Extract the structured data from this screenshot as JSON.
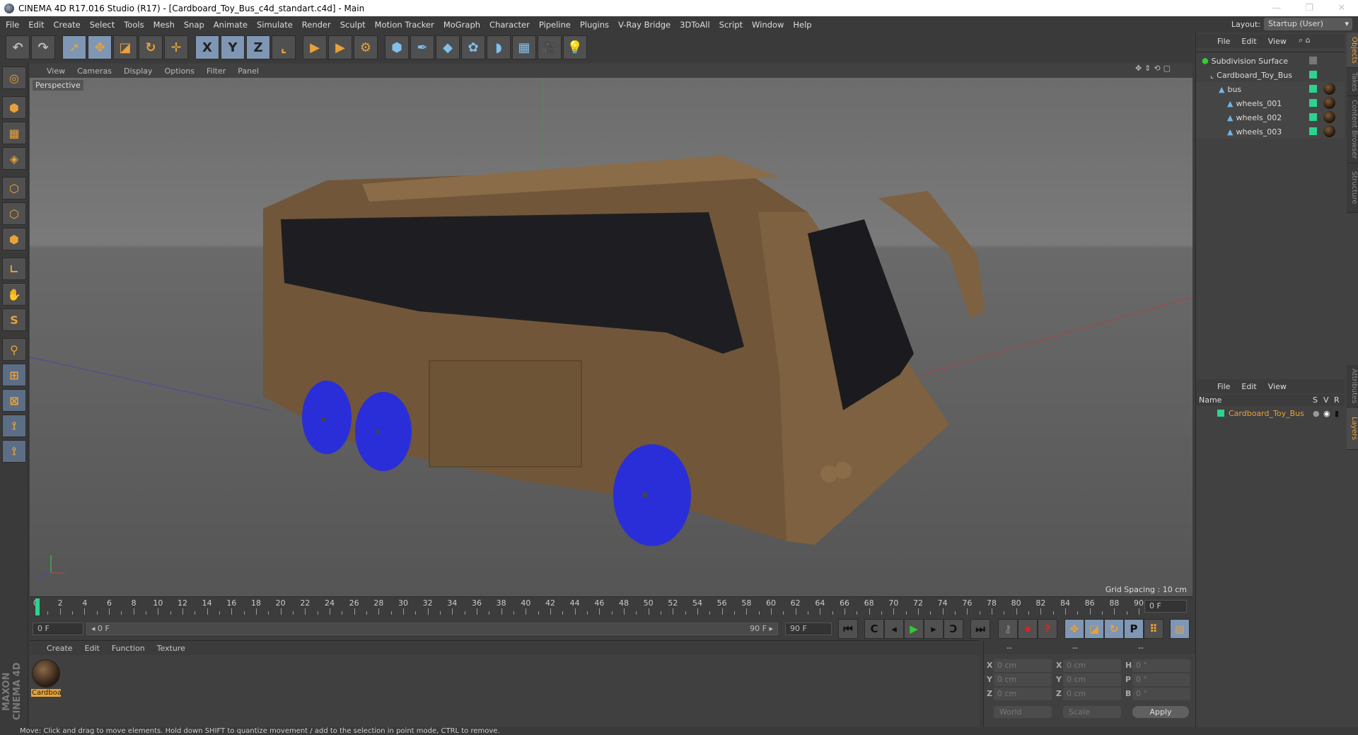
{
  "title": "CINEMA 4D R17.016 Studio (R17) - [Cardboard_Toy_Bus_c4d_standart.c4d] - Main",
  "menu": [
    "File",
    "Edit",
    "Create",
    "Select",
    "Tools",
    "Mesh",
    "Snap",
    "Animate",
    "Simulate",
    "Render",
    "Sculpt",
    "Motion Tracker",
    "MoGraph",
    "Character",
    "Pipeline",
    "Plugins",
    "V-Ray Bridge",
    "3DToAll",
    "Script",
    "Window",
    "Help"
  ],
  "layout": {
    "label": "Layout:",
    "value": "Startup (User)"
  },
  "toolbar": [
    {
      "icon": "undo-icon",
      "glyph": "↶"
    },
    {
      "icon": "redo-icon",
      "glyph": "↷"
    },
    {
      "icon": "select-icon",
      "glyph": "➚",
      "on": true
    },
    {
      "icon": "move-icon",
      "glyph": "✥",
      "on": true
    },
    {
      "icon": "scale-icon",
      "glyph": "◪"
    },
    {
      "icon": "rotate-icon",
      "glyph": "↻"
    },
    {
      "icon": "move-recent-icon",
      "glyph": "✛"
    },
    {
      "icon": "x-axis-icon",
      "glyph": "X",
      "on": true
    },
    {
      "icon": "y-axis-icon",
      "glyph": "Y",
      "on": true
    },
    {
      "icon": "z-axis-icon",
      "glyph": "Z",
      "on": true
    },
    {
      "icon": "coordinate-system-icon",
      "glyph": "⌞"
    },
    {
      "icon": "render-view-icon",
      "glyph": "▶"
    },
    {
      "icon": "render-picture-viewer-icon",
      "glyph": "▶"
    },
    {
      "icon": "render-settings-icon",
      "glyph": "⚙"
    },
    {
      "icon": "cube-icon",
      "glyph": "⬢"
    },
    {
      "icon": "pen-icon",
      "glyph": "✒"
    },
    {
      "icon": "subdivision-icon",
      "glyph": "◆"
    },
    {
      "icon": "mograph-cloner-icon",
      "glyph": "✿"
    },
    {
      "icon": "deformer-icon",
      "glyph": "◗"
    },
    {
      "icon": "floor-icon",
      "glyph": "▦"
    },
    {
      "icon": "camera-icon",
      "glyph": "🎥"
    },
    {
      "icon": "light-icon",
      "glyph": "💡"
    }
  ],
  "left_tools": [
    "model-mode-icon",
    "object-mode-icon",
    "texture-mode-icon",
    "workplane-icon",
    "points-mode-icon",
    "edges-mode-icon",
    "polygons-mode-icon",
    "axis-icon",
    "tweak-icon",
    "soft-selection-icon",
    "magnet-icon",
    "snap-icon",
    "snap-settings-icon",
    "python-icon",
    "python-icon"
  ],
  "maxon": "MAXON CINEMA 4D",
  "viewport": {
    "menu": [
      "View",
      "Cameras",
      "Display",
      "Options",
      "Filter",
      "Panel"
    ],
    "camera": "Perspective",
    "grid_spacing": "Grid Spacing : 10 cm",
    "colors": {
      "cardboard": "#7a5e3e",
      "wheels": "#2a2ee0"
    }
  },
  "timeline": {
    "start": 0,
    "end": 90,
    "step": 2,
    "current": "0 F"
  },
  "controls": {
    "start_field": "0 F",
    "range_start": "◂ 0 F",
    "range_end": "90 F ▸",
    "end_field": "90 F"
  },
  "materials": {
    "menu": [
      "Create",
      "Edit",
      "Function",
      "Texture"
    ],
    "items": [
      {
        "name": "Cardboa"
      }
    ]
  },
  "coords": {
    "headers": [
      "--",
      "--",
      "--"
    ],
    "rows": [
      {
        "a": "X",
        "av": "0 cm",
        "b": "X",
        "bv": "0 cm",
        "c": "H",
        "cv": "0 °"
      },
      {
        "a": "Y",
        "av": "0 cm",
        "b": "Y",
        "bv": "0 cm",
        "c": "P",
        "cv": "0 °"
      },
      {
        "a": "Z",
        "av": "0 cm",
        "b": "Z",
        "bv": "0 cm",
        "c": "B",
        "cv": "0 °"
      }
    ],
    "mode": "World",
    "type": "Scale",
    "apply": "Apply"
  },
  "objects": {
    "menu": [
      "File",
      "Edit",
      "View"
    ],
    "items": [
      {
        "name": "Subdivision Surface",
        "indent": 0,
        "icon": "subdivision-icon"
      },
      {
        "name": "Cardboard_Toy_Bus",
        "indent": 1,
        "icon": "null-icon"
      },
      {
        "name": "bus",
        "indent": 2,
        "icon": "polygon-icon"
      },
      {
        "name": "wheels_001",
        "indent": 3,
        "icon": "polygon-icon"
      },
      {
        "name": "wheels_002",
        "indent": 3,
        "icon": "polygon-icon"
      },
      {
        "name": "wheels_003",
        "indent": 3,
        "icon": "polygon-icon"
      }
    ]
  },
  "layers": {
    "menu": [
      "File",
      "Edit",
      "View"
    ],
    "cols": [
      "Name",
      "S",
      "V",
      "R"
    ],
    "items": [
      {
        "name": "Cardboard_Toy_Bus",
        "color": "#2dd28f"
      }
    ]
  },
  "side_tabs": [
    "Objects",
    "Takes",
    "Content Browser",
    "Structure"
  ],
  "side_tabs_lower": [
    "Attributes",
    "Layers"
  ],
  "status": "Move: Click and drag to move elements. Hold down SHIFT to quantize movement / add to the selection in point mode, CTRL to remove."
}
